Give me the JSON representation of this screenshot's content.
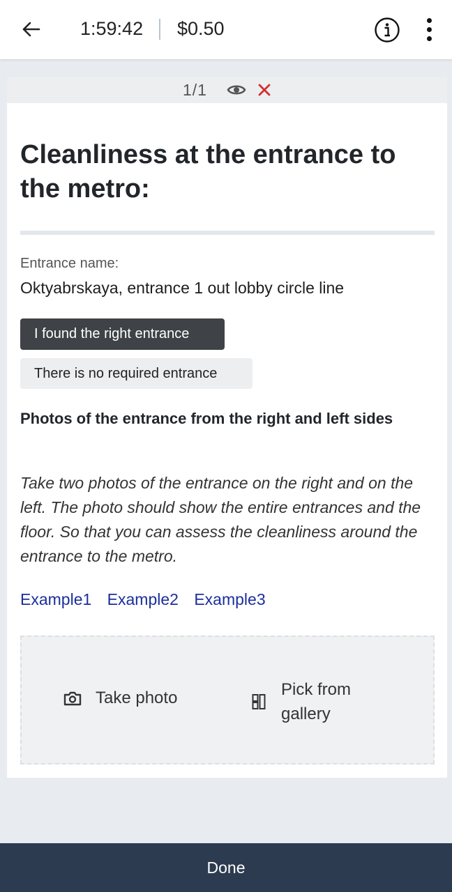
{
  "topbar": {
    "back_icon": "arrow-left-icon",
    "timer": "1:59:42",
    "price": "$0.50",
    "info_icon": "info-circle-icon",
    "more_icon": "more-vertical-icon"
  },
  "card_header": {
    "counter": "1/1",
    "eye_icon": "eye-icon",
    "close_icon": "close-x-icon",
    "close_color": "#d32f2f"
  },
  "task": {
    "title": "Cleanliness at the entrance to the metro:",
    "entrance_label": "Entrance name:",
    "entrance_value": "Oktyabrskaya, entrance 1 out lobby circle line",
    "found_button": "I found the right entrance",
    "no_entrance_button": "There is no required entrance",
    "photos_title": "Photos of the entrance from the right and left sides",
    "photos_description": "Take two photos of the entrance on the right and on the left. The photo should show the entire entrances and the floor. So that you can assess the cleanliness around the entrance to the metro.",
    "examples": [
      "Example1",
      "Example2",
      "Example3"
    ]
  },
  "upload": {
    "take_photo_label": "Take photo",
    "take_photo_icon": "camera-icon",
    "gallery_label": "Pick from gallery",
    "gallery_icon": "gallery-icon"
  },
  "footer": {
    "done_label": "Done"
  },
  "colors": {
    "accent_link": "#1b2f9b",
    "bottom_bar": "#2c3b50",
    "primary_button": "#3f4246"
  }
}
